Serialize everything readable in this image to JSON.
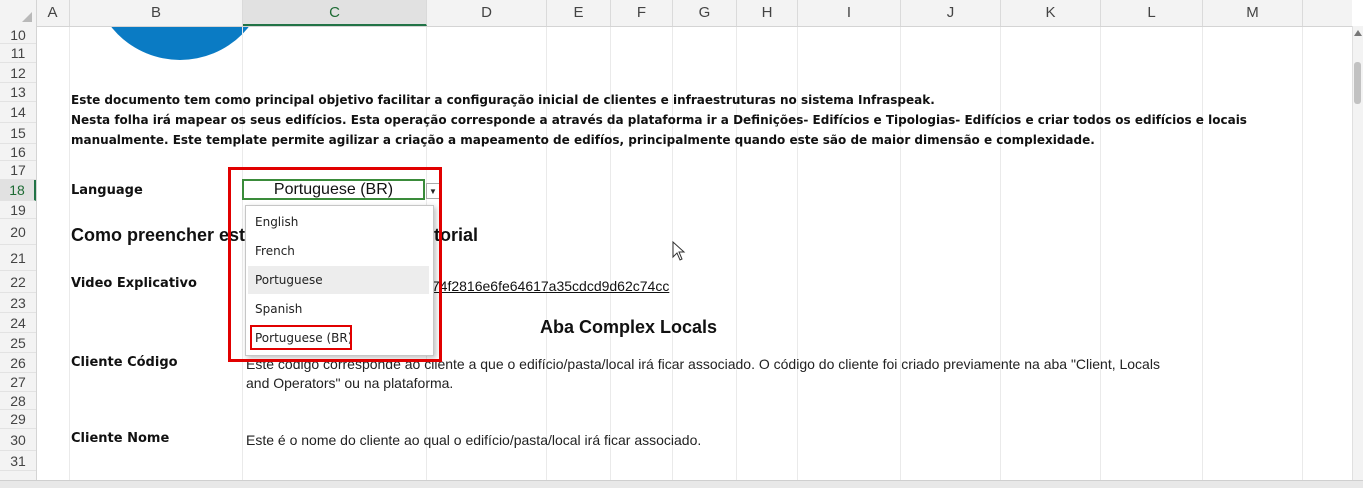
{
  "columns": [
    "A",
    "B",
    "C",
    "D",
    "E",
    "F",
    "G",
    "H",
    "I",
    "J",
    "K",
    "L",
    "M"
  ],
  "active_column": "C",
  "rows": [
    "10",
    "11",
    "12",
    "13",
    "14",
    "15",
    "16",
    "17",
    "18",
    "19",
    "20",
    "21",
    "22",
    "23",
    "24",
    "25",
    "26",
    "27",
    "28",
    "29",
    "30",
    "31"
  ],
  "active_row": "18",
  "description": {
    "line1": "Este documento tem como principal objetivo facilitar a configuração inicial de clientes e infraestruturas no sistema Infraspeak.",
    "line2": "Nesta folha irá mapear os seus edifícios. Esta operação corresponde a através da plataforma ir a Definições- Edifícios e Tipologias- Edifícios e criar todos os edifícios e locais",
    "line3": "manualmente. Este template permite agilizar a criação a mapeamento de edifíos, principalmente quando este são de maior dimensão e complexidade."
  },
  "language": {
    "label": "Language",
    "value": "Portuguese (BR)",
    "options": [
      "English",
      "French",
      "Portuguese",
      "Spanish",
      "Portuguese (BR)"
    ],
    "hovered_option": "Portuguese",
    "highlighted_option": "Portuguese (BR)"
  },
  "heading": {
    "left": "Como preencher est",
    "right": "torial"
  },
  "video": {
    "label": "Video Explicativo",
    "link_fragment": "/74f2816e6fe64617a35cdcd9d62c74cc"
  },
  "section_title": "Aba Complex Locals",
  "cliente_codigo": {
    "label": "Cliente Código",
    "line1": "Este código corresponde ao cliente a que o edifício/pasta/local irá ficar associado. O código do cliente foi criado previamente na aba \"Client, Locals",
    "line2": "and Operators\" ou na plataforma."
  },
  "cliente_nome": {
    "label": "Cliente Nome",
    "text": "Este é o nome do cliente ao qual o edifício/pasta/local irá ficar associado."
  },
  "colors": {
    "accent_green": "#217346",
    "highlight_red": "#e10000",
    "logo_blue": "#0a7bc4"
  }
}
